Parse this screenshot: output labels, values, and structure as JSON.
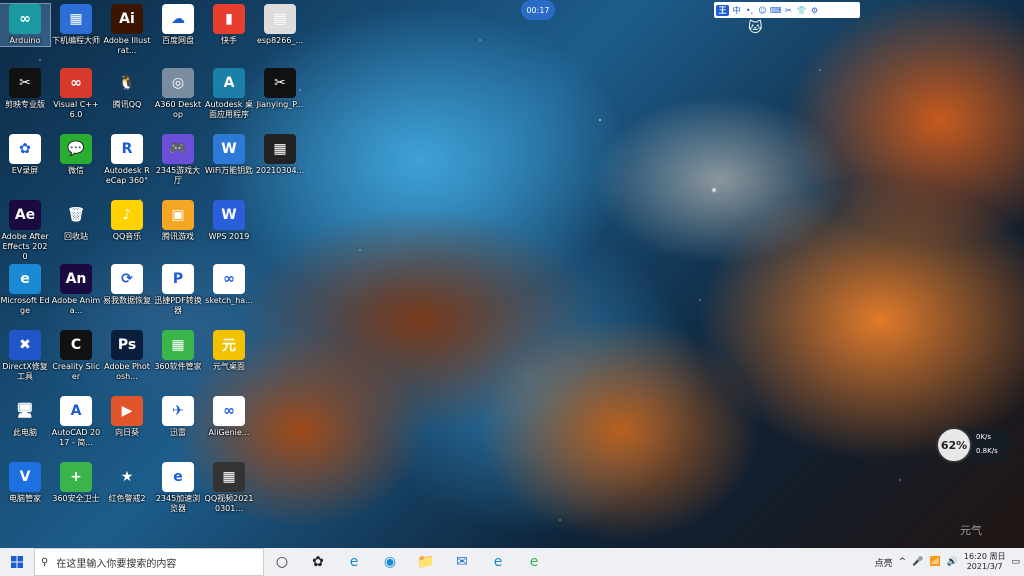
{
  "desktop": {
    "icons": [
      {
        "label": "Arduino",
        "glyph": "∞",
        "bg": "#1a9aa0"
      },
      {
        "label": "下机编程大师",
        "glyph": "▦",
        "bg": "#2d6ed6"
      },
      {
        "label": "Adobe Illustrat...",
        "glyph": "Ai",
        "bg": "#3b1500"
      },
      {
        "label": "百度网盘",
        "glyph": "☁",
        "bg": "#ffffff"
      },
      {
        "label": "快手",
        "glyph": "▮",
        "bg": "#e83e2e"
      },
      {
        "label": "esp8266_...",
        "glyph": "▤",
        "bg": "#dddddd"
      },
      {
        "label": "剪映专业版",
        "glyph": "✂",
        "bg": "#111111"
      },
      {
        "label": "Visual C++ 6.0",
        "glyph": "∞",
        "bg": "#d73a2a"
      },
      {
        "label": "腾讯QQ",
        "glyph": "🐧",
        "bg": "transparent"
      },
      {
        "label": "A360 Desktop",
        "glyph": "◎",
        "bg": "#7a8da0"
      },
      {
        "label": "Autodesk 桌面应用程序",
        "glyph": "A",
        "bg": "#1b7fa8"
      },
      {
        "label": "Jianying_P...",
        "glyph": "✂",
        "bg": "#111111"
      },
      {
        "label": "EV录屏",
        "glyph": "✿",
        "bg": "#ffffff"
      },
      {
        "label": "微信",
        "glyph": "💬",
        "bg": "#2aae32"
      },
      {
        "label": "Autodesk ReCap 360°",
        "glyph": "R",
        "bg": "#ffffff"
      },
      {
        "label": "2345游戏大厅",
        "glyph": "🎮",
        "bg": "#6b4fd8"
      },
      {
        "label": "WiFi万能钥匙",
        "glyph": "W",
        "bg": "#2d7ad6"
      },
      {
        "label": "20210304...",
        "glyph": "▦",
        "bg": "#222222"
      },
      {
        "label": "Adobe After Effects 2020",
        "glyph": "Ae",
        "bg": "#1a0a40"
      },
      {
        "label": "回收站",
        "glyph": "🗑",
        "bg": "transparent"
      },
      {
        "label": "QQ音乐",
        "glyph": "♪",
        "bg": "#ffd200"
      },
      {
        "label": "腾讯游戏",
        "glyph": "▣",
        "bg": "#f5a623"
      },
      {
        "label": "WPS 2019",
        "glyph": "W",
        "bg": "#2b5fd9"
      },
      {
        "label": "Microsoft Edge",
        "glyph": "e",
        "bg": "#1a8ad4"
      },
      {
        "label": "Adobe Anima...",
        "glyph": "An",
        "bg": "#1a0a40"
      },
      {
        "label": "易我数据恢复",
        "glyph": "⟳",
        "bg": "#ffffff"
      },
      {
        "label": "迅捷PDF转换器",
        "glyph": "P",
        "bg": "#ffffff"
      },
      {
        "label": "sketch_ha...",
        "glyph": "∞",
        "bg": "#ffffff"
      },
      {
        "label": "DirectX修复工具",
        "glyph": "✖",
        "bg": "#2256c8"
      },
      {
        "label": "Creality Slicer",
        "glyph": "C",
        "bg": "#111111"
      },
      {
        "label": "Adobe Photosh...",
        "glyph": "Ps",
        "bg": "#0a1e3c"
      },
      {
        "label": "360软件管家",
        "glyph": "▦",
        "bg": "#3ab54a"
      },
      {
        "label": "元气桌面",
        "glyph": "元",
        "bg": "#f2c200"
      },
      {
        "label": "此电脑",
        "glyph": "🖥",
        "bg": "transparent"
      },
      {
        "label": "AutoCAD 2017 - 简...",
        "glyph": "A",
        "bg": "#ffffff"
      },
      {
        "label": "向日葵",
        "glyph": "▶",
        "bg": "#e0552a"
      },
      {
        "label": "迅雷",
        "glyph": "✈",
        "bg": "#ffffff"
      },
      {
        "label": "AliGenie...",
        "glyph": "∞",
        "bg": "#ffffff"
      },
      {
        "label": "电脑管家",
        "glyph": "V",
        "bg": "#1e6fe0"
      },
      {
        "label": "360安全卫士",
        "glyph": "+",
        "bg": "#3ab54a"
      },
      {
        "label": "红色警戒2",
        "glyph": "★",
        "bg": "transparent"
      },
      {
        "label": "2345加速浏览器",
        "glyph": "e",
        "bg": "#ffffff"
      },
      {
        "label": "QQ视频20210301...",
        "glyph": "▦",
        "bg": "#333333"
      }
    ]
  },
  "overlay": {
    "recording_time": "00:17",
    "ime_logo": "王",
    "ime_items": [
      "中",
      "•,",
      "☺",
      "⌨",
      "✂",
      "👕",
      "⚙"
    ],
    "net_widget": {
      "percent": "62%",
      "up": "0K/s",
      "down": "0.8K/s"
    },
    "watermark": "元气"
  },
  "taskbar": {
    "search_placeholder": "在这里输入你要搜索的内容",
    "tray_text": "点亮",
    "time": "16:20 周日",
    "date": "2021/3/7",
    "apps": [
      "○",
      "✿",
      "e",
      "◉",
      "📁",
      "✉",
      "e",
      "e"
    ]
  },
  "colors": {
    "taskbar_bg": "#eef0f4",
    "accent": "#1b5bd3"
  }
}
